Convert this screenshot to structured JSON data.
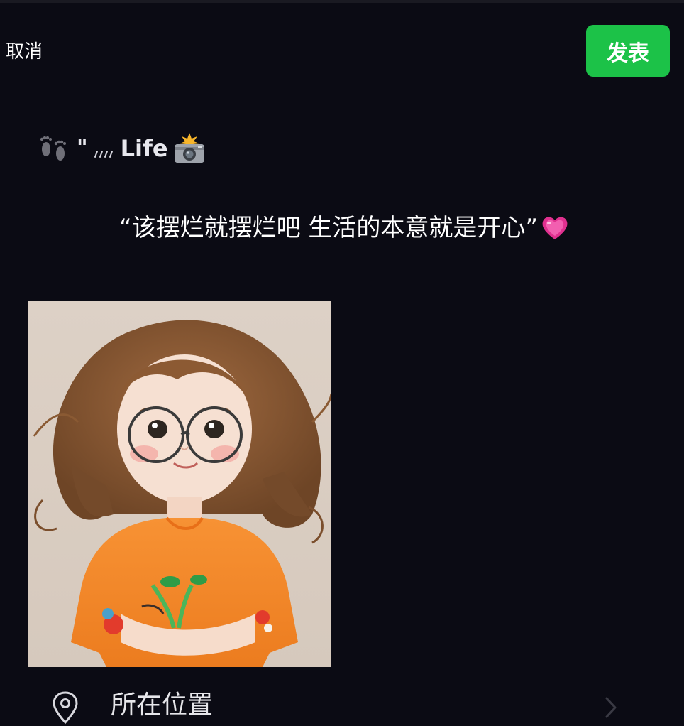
{
  "header": {
    "cancel_label": "取消",
    "publish_label": "发表",
    "publish_color": "#1cc248"
  },
  "signature": {
    "icons": [
      "footprints-icon",
      "slashes-icon",
      "camera-flash-icon"
    ],
    "quote": "\"",
    "text": "Life"
  },
  "post": {
    "text": "“该摆烂就摆烂吧 生活的本意就是开心”",
    "emoji_icon": "pink-heart-icon"
  },
  "attachment": {
    "image_icon": "cartoon-girl-image"
  },
  "location": {
    "label": "所在位置",
    "icon": "location-pin-icon",
    "chevron_icon": "chevron-right-icon"
  },
  "colors": {
    "background": "#0b0b14",
    "accent": "#1cc248",
    "text": "#ffffff"
  }
}
